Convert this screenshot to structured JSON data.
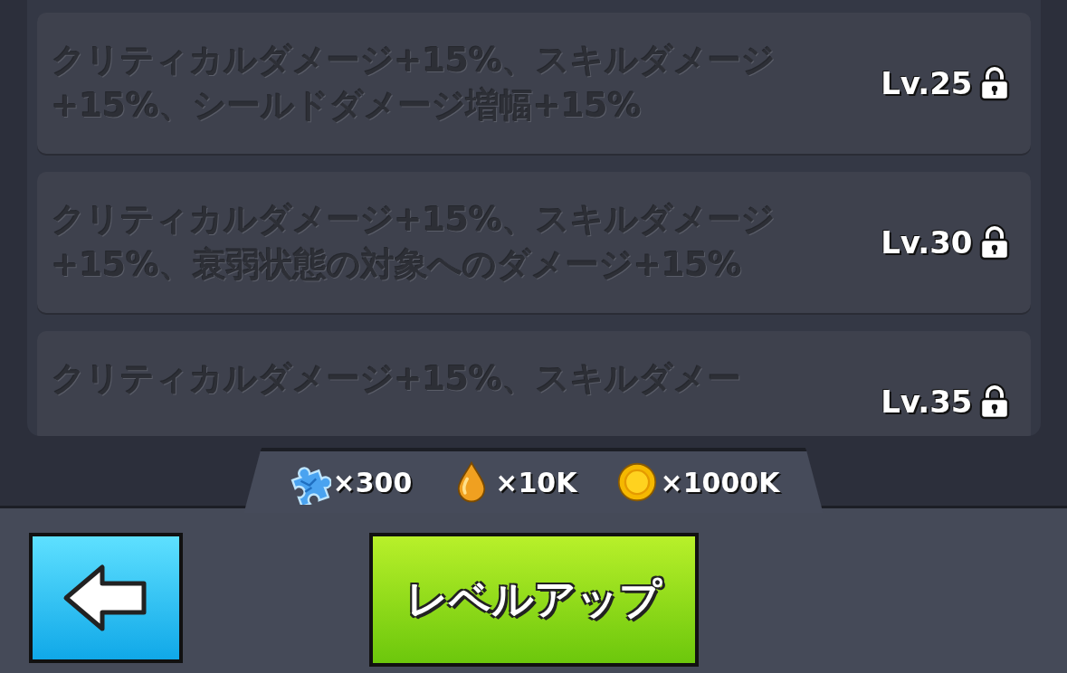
{
  "bonuses": [
    {
      "text": "クリティカルダメージ+15%、スキルダメージ+15%、シールドダメージ増幅+15%",
      "level": "Lv.25",
      "locked": true
    },
    {
      "text": "クリティカルダメージ+15%、スキルダメージ+15%、衰弱状態の対象へのダメージ+15%",
      "level": "Lv.30",
      "locked": true
    },
    {
      "text": "クリティカルダメージ+15%、スキルダメー",
      "level": "Lv.35",
      "locked": true
    }
  ],
  "costs": [
    {
      "kind": "puzzle",
      "amount": "×300"
    },
    {
      "kind": "drop",
      "amount": "×10K"
    },
    {
      "kind": "coin",
      "amount": "×1000K"
    }
  ],
  "back_button": {
    "kind": "arrow"
  },
  "level_up_button": {
    "label": "レベルアップ"
  }
}
